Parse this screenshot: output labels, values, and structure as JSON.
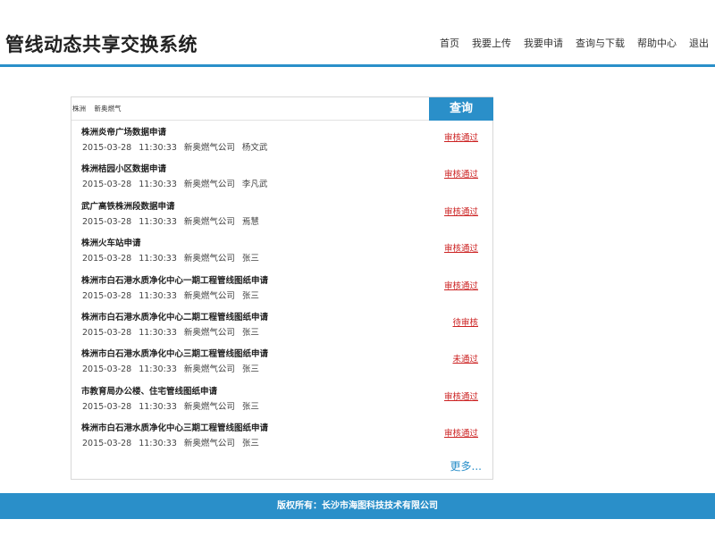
{
  "header": {
    "title": "管线动态共享交换系统",
    "nav": [
      "首页",
      "我要上传",
      "我要申请",
      "查询与下载",
      "帮助中心",
      "退出"
    ]
  },
  "search": {
    "value": "株洲    新奥燃气",
    "button_label": "查询"
  },
  "list": {
    "items": [
      {
        "title": "株洲炎帝广场数据申请",
        "date": "2015-03-28",
        "time": "11:30:33",
        "company": "新奥燃气公司",
        "user": "杨文武",
        "status": "审核通过"
      },
      {
        "title": "株洲桔园小区数据申请",
        "date": "2015-03-28",
        "time": "11:30:33",
        "company": "新奥燃气公司",
        "user": "李凡武",
        "status": "审核通过"
      },
      {
        "title": "武广高铁株洲段数据申请",
        "date": "2015-03-28",
        "time": "11:30:33",
        "company": "新奥燃气公司",
        "user": "焉慧",
        "status": "审核通过"
      },
      {
        "title": "株洲火车站申请",
        "date": "2015-03-28",
        "time": "11:30:33",
        "company": "新奥燃气公司",
        "user": "张三",
        "status": "审核通过"
      },
      {
        "title": "株洲市白石港水质净化中心一期工程管线图纸申请",
        "date": "2015-03-28",
        "time": "11:30:33",
        "company": "新奥燃气公司",
        "user": "张三",
        "status": "审核通过"
      },
      {
        "title": "株洲市白石港水质净化中心二期工程管线图纸申请",
        "date": "2015-03-28",
        "time": "11:30:33",
        "company": "新奥燃气公司",
        "user": "张三",
        "status": "待审核"
      },
      {
        "title": "株洲市白石港水质净化中心三期工程管线图纸申请",
        "date": "2015-03-28",
        "time": "11:30:33",
        "company": "新奥燃气公司",
        "user": "张三",
        "status": "未通过"
      },
      {
        "title": "市教育局办公楼、住宅管线图纸申请",
        "date": "2015-03-28",
        "time": "11:30:33",
        "company": "新奥燃气公司",
        "user": "张三",
        "status": "审核通过"
      },
      {
        "title": "株洲市白石港水质净化中心三期工程管线图纸申请",
        "date": "2015-03-28",
        "time": "11:30:33",
        "company": "新奥燃气公司",
        "user": "张三",
        "status": "审核通过"
      }
    ],
    "more_label": "更多..."
  },
  "footer": {
    "text": "版权所有：长沙市海图科技技术有限公司"
  },
  "colors": {
    "accent": "#2a8fc9",
    "status": "#cc2222"
  }
}
